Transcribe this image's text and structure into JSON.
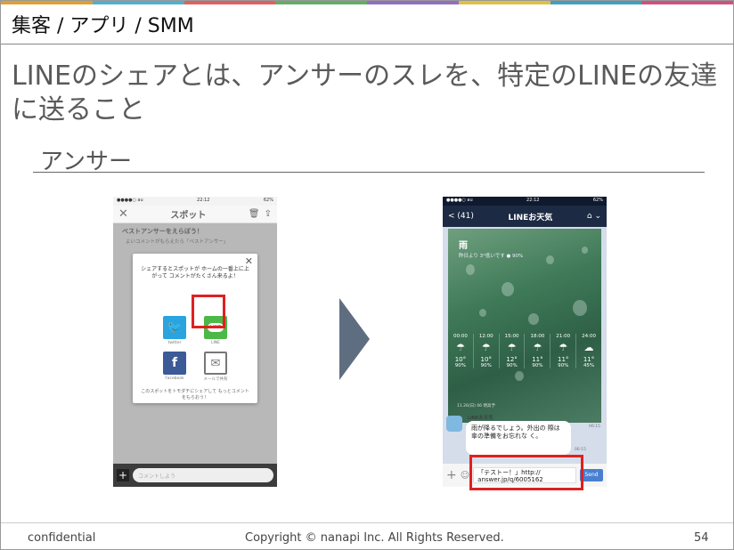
{
  "header": {
    "title": "集客 / アプリ / SMM"
  },
  "slide": {
    "title": "LINEのシェアとは、アンサーのスレを、特定のLINEの友達に送ること",
    "subtitle": "アンサー"
  },
  "phone1": {
    "status_left": "●●●●○ au",
    "status_time": "22:12",
    "status_right": "62%",
    "nav_close": "✕",
    "nav_title": "スポット",
    "banner": "ベストアンサーをえらぼう！",
    "banner_sub": "よいコメントがもらえたら「ベストアンサー」",
    "modal_message": "シェアするとスポットが ホームの一番上に上がって コメントがたくさん来るよ！",
    "modal_close": "✕",
    "twitter_label": "twitter",
    "line_label": "LINE",
    "line_icon_text": "LINE",
    "facebook_label": "Facebook",
    "mail_label": "メールで共有",
    "modal_footer": "このスポットをトモダチにシェアして もっとコメントをもらおう！",
    "input_placeholder": "コメントしよう",
    "plus": "+"
  },
  "phone2": {
    "status_left": "●●●●○ au",
    "status_time": "22:12",
    "status_right": "62%",
    "nav_back": "< (41)",
    "nav_title": "LINEお天気",
    "weather_main": "雨",
    "weather_sub": "昨日より 3°低いです ● 90%",
    "forecast": [
      {
        "time": "00:00",
        "icon": "☂",
        "temp": "10°",
        "pct": "90%"
      },
      {
        "time": "12:00",
        "icon": "☂",
        "temp": "10°",
        "pct": "90%"
      },
      {
        "time": "15:00",
        "icon": "☂",
        "temp": "12°",
        "pct": "90%"
      },
      {
        "time": "18:00",
        "icon": "☂",
        "temp": "11°",
        "pct": "90%"
      },
      {
        "time": "21:00",
        "icon": "☂",
        "temp": "11°",
        "pct": "90%"
      },
      {
        "time": "24:00",
        "icon": "☁",
        "temp": "11°",
        "pct": "45%"
      }
    ],
    "weather_date": "11.26(日) 06 明高予",
    "time1": "06:15",
    "sender": "LINEお天気",
    "bubble": "雨が降るでしょう。外出の 際は傘の準備をお忘れな く。",
    "time2": "06:15",
    "input_text": "「テストー！」http:// answer.jp/q/6005162",
    "send_label": "Send",
    "plus": "+"
  },
  "footer": {
    "left": "confidential",
    "center": "Copyright © nanapi Inc. All Rights Reserved.",
    "page": "54"
  },
  "colors": {
    "accent_red": "#e02020",
    "arrow": "#5f6d80",
    "line_green": "#4cb848",
    "twitter_blue": "#2aa3df",
    "facebook_blue": "#3b5a96"
  }
}
